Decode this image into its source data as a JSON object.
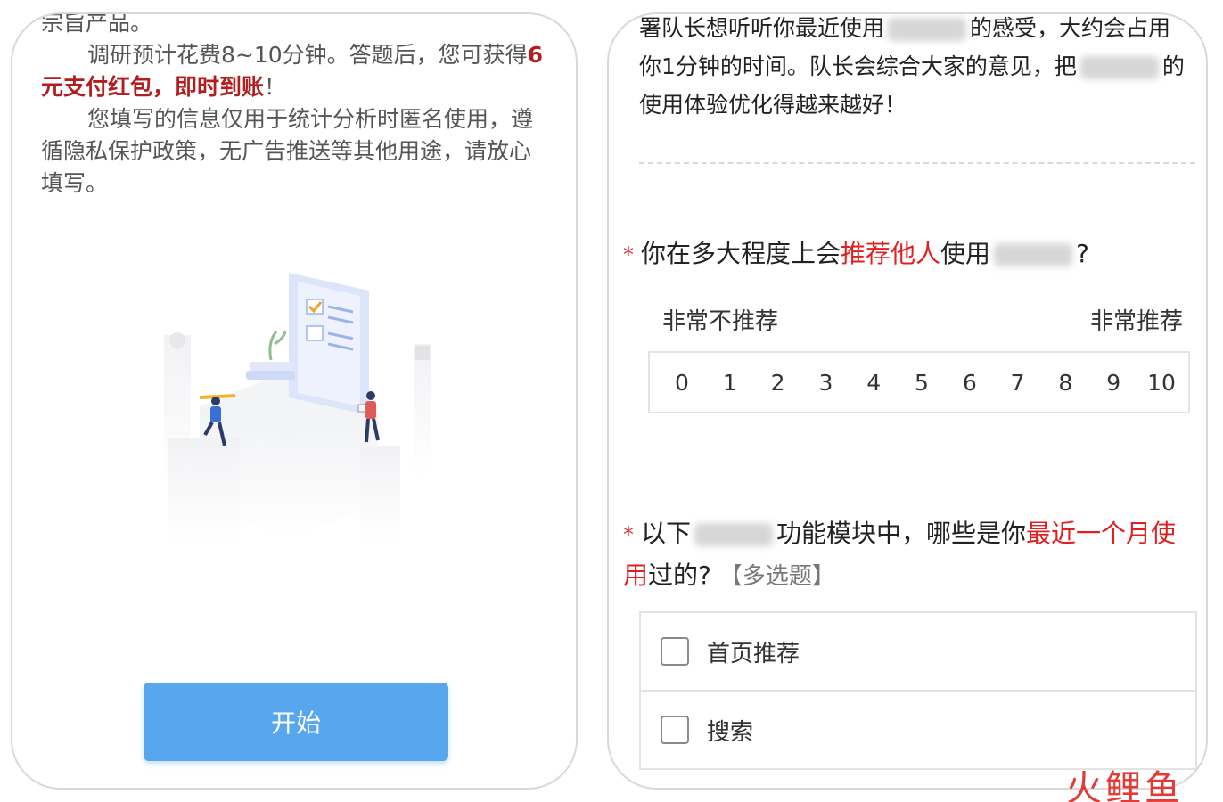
{
  "left": {
    "intro": {
      "line_top": "宗旨产品。",
      "p1_before": "调研预计花费8~10分钟。答题后，您可获得",
      "p1_highlight": "6元支付红包，即时到账",
      "p1_after": "！",
      "p2": "您填写的信息仅用于统计分析时匿名使用，遵循隐私保护政策，无广告推送等其他用途，请放心填写。"
    },
    "start_button": "开始"
  },
  "right": {
    "intro": {
      "seg1": "署队长想听听你最近使用",
      "seg2": "的感受，大约会占用你1分钟的时间。队长会综合大家的意见，把",
      "seg3": "的使用体验优化得越来越好！"
    },
    "q1": {
      "star": "*",
      "text_before": "你在多大程度上会",
      "highlight": "推荐他人",
      "text_after": "使用",
      "end": "?",
      "scale_low_label": "非常不推荐",
      "scale_high_label": "非常推荐",
      "scale": [
        "0",
        "1",
        "2",
        "3",
        "4",
        "5",
        "6",
        "7",
        "8",
        "9",
        "10"
      ]
    },
    "q2": {
      "star": "*",
      "text_before": "以下",
      "text_mid": "功能模块中，哪些是你",
      "highlight": "最近一个月使用",
      "text_after": "过的?",
      "tag": "【多选题】",
      "options": [
        "首页推荐",
        "搜索"
      ]
    }
  },
  "watermark": "火鲤鱼",
  "colors": {
    "accent_red": "#e02020",
    "button_blue": "#58a6ee"
  }
}
